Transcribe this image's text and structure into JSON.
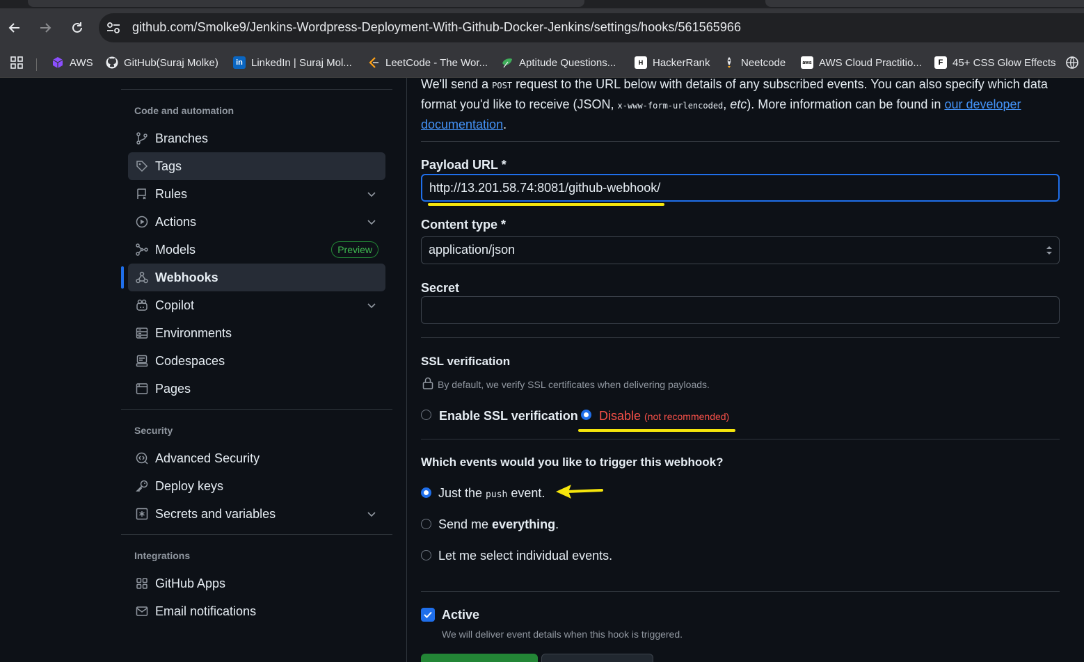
{
  "browser": {
    "url": "github.com/Smolke9/Jenkins-Wordpress-Deployment-With-Github-Docker-Jenkins/settings/hooks/561565966",
    "bookmarks": [
      {
        "label": "AWS"
      },
      {
        "label": "GitHub(Suraj Molke)"
      },
      {
        "label": "LinkedIn | Suraj Mol..."
      },
      {
        "label": "LeetCode - The Wor..."
      },
      {
        "label": "Aptitude Questions..."
      },
      {
        "label": "HackerRank"
      },
      {
        "label": "Neetcode"
      },
      {
        "label": "AWS Cloud Practitio..."
      },
      {
        "label": "45+ CSS Glow Effects"
      }
    ]
  },
  "sidebar": {
    "code_heading": "Code and automation",
    "code_items": [
      {
        "label": "Branches",
        "icon": "git-branch-icon"
      },
      {
        "label": "Tags",
        "icon": "tag-icon"
      },
      {
        "label": "Rules",
        "icon": "repo-push-icon"
      },
      {
        "label": "Actions",
        "icon": "play-icon"
      },
      {
        "label": "Models",
        "icon": "models-icon",
        "badge": "Preview"
      },
      {
        "label": "Webhooks",
        "icon": "webhook-icon"
      },
      {
        "label": "Copilot",
        "icon": "copilot-icon"
      },
      {
        "label": "Environments",
        "icon": "server-icon"
      },
      {
        "label": "Codespaces",
        "icon": "codespaces-icon"
      },
      {
        "label": "Pages",
        "icon": "browser-icon"
      }
    ],
    "security_heading": "Security",
    "security_items": [
      {
        "label": "Advanced Security",
        "icon": "codescan-icon"
      },
      {
        "label": "Deploy keys",
        "icon": "key-icon"
      },
      {
        "label": "Secrets and variables",
        "icon": "key-asterisk-icon"
      }
    ],
    "integrations_heading": "Integrations",
    "integrations_items": [
      {
        "label": "GitHub Apps",
        "icon": "apps-icon"
      },
      {
        "label": "Email notifications",
        "icon": "mail-icon"
      }
    ]
  },
  "form": {
    "intro_part1": "We'll send a ",
    "intro_code1": "POST",
    "intro_part2": " request to the URL below with details of any subscribed events. You can also specify which data format you'd like to receive (JSON, ",
    "intro_code2": "x-www-form-urlencoded",
    "intro_part3": ", ",
    "intro_etc": "etc",
    "intro_part4": "). More information can be found in ",
    "intro_link": "our developer documentation",
    "intro_end": ".",
    "payload_label": "Payload URL *",
    "payload_value": "http://13.201.58.74:8081/github-webhook/",
    "content_type_label": "Content type *",
    "content_type_value": "application/json",
    "secret_label": "Secret",
    "secret_value": "",
    "ssl_heading": "SSL verification",
    "ssl_note": "By default, we verify SSL certificates when delivering payloads.",
    "ssl_enable_label": "Enable SSL verification",
    "ssl_disable_label": "Disable",
    "ssl_disable_note": "(not recommended)",
    "events_heading": "Which events would you like to trigger this webhook?",
    "event_push_pre": "Just the ",
    "event_push_code": "push",
    "event_push_post": " event.",
    "event_all_pre": "Send me ",
    "event_all_bold": "everything",
    "event_all_post": ".",
    "event_select": "Let me select individual events.",
    "active_label": "Active",
    "active_note": "We will deliver event details when this hook is triggered.",
    "active_checked": true,
    "ssl_selected": "disable",
    "event_selected": "push"
  },
  "colors": {
    "accent": "#1f6feb",
    "danger": "#f85149",
    "annotation": "#f5e50c"
  }
}
